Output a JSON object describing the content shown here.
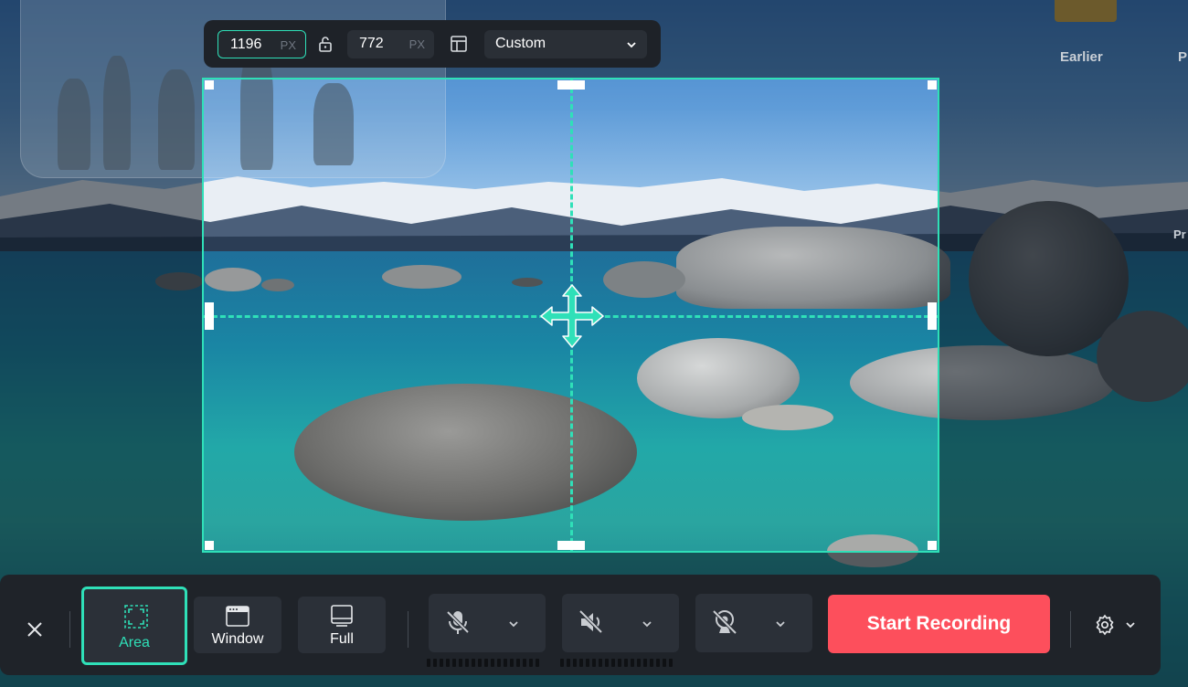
{
  "desktop": {
    "labels": [
      "Earlier",
      "P",
      "Pr"
    ]
  },
  "size_toolbar": {
    "width_value": "1196",
    "width_unit": "PX",
    "height_value": "772",
    "height_unit": "PX",
    "lock_icon": "unlock-icon",
    "layout_icon": "layout-icon",
    "preset_value": "Custom"
  },
  "selection": {
    "move_icon": "move-arrows-icon"
  },
  "record_bar": {
    "modes": [
      {
        "label": "Area",
        "icon": "area-select-icon",
        "active": true
      },
      {
        "label": "Window",
        "icon": "window-icon",
        "active": false
      },
      {
        "label": "Full",
        "icon": "fullscreen-icon",
        "active": false
      }
    ],
    "devices": [
      {
        "icon": "microphone-muted-icon"
      },
      {
        "icon": "speaker-muted-icon"
      },
      {
        "icon": "webcam-off-icon"
      }
    ],
    "start_label": "Start Recording",
    "settings_icon": "gear-icon",
    "colors": {
      "accent": "#2fe0b8",
      "start": "#fd4f5c",
      "bar": "#1f2329"
    }
  }
}
